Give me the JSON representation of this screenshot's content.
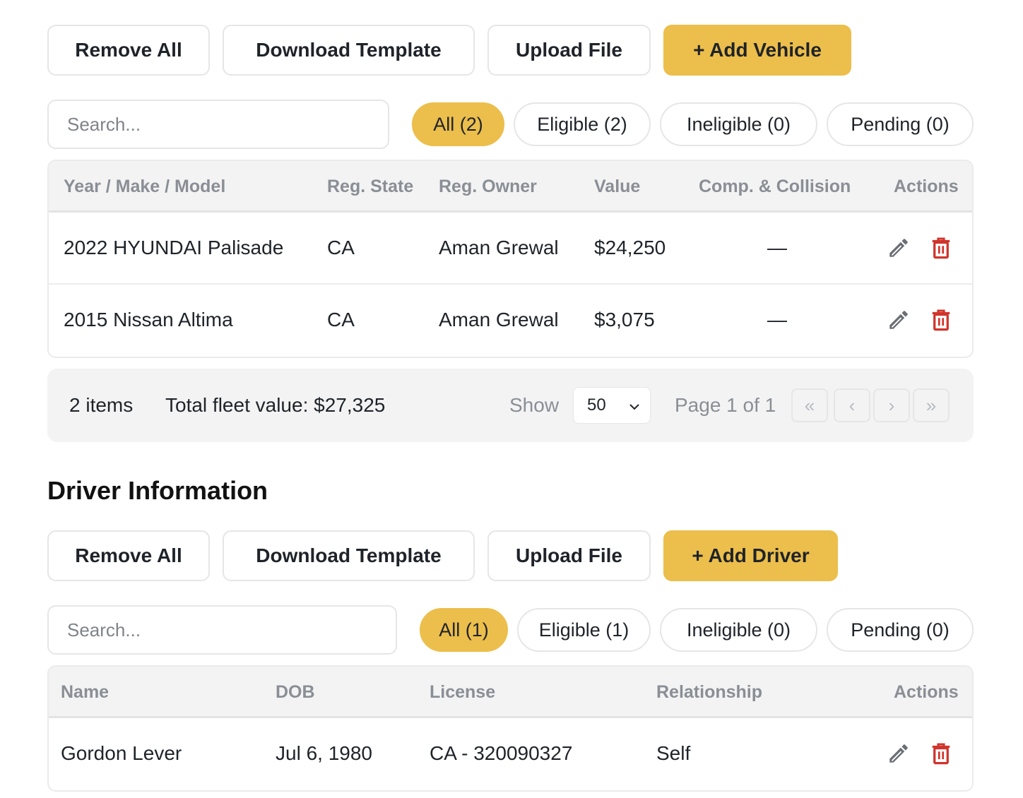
{
  "vehicles": {
    "toolbar": {
      "remove_all": "Remove All",
      "download_template": "Download Template",
      "upload_file": "Upload File",
      "add": "+ Add Vehicle"
    },
    "search": {
      "placeholder": "Search...",
      "value": ""
    },
    "filters": {
      "all": "All (2)",
      "eligible": "Eligible (2)",
      "ineligible": "Ineligible (0)",
      "pending": "Pending (0)"
    },
    "table": {
      "headers": {
        "ymm": "Year / Make / Model",
        "state": "Reg. State",
        "owner": "Reg. Owner",
        "value": "Value",
        "comp": "Comp. & Collision",
        "actions": "Actions"
      },
      "rows": [
        {
          "ymm": "2022 HYUNDAI Palisade",
          "state": "CA",
          "owner": "Aman Grewal",
          "value": "$24,250",
          "comp": "—"
        },
        {
          "ymm": "2015 Nissan Altima",
          "state": "CA",
          "owner": "Aman Grewal",
          "value": "$3,075",
          "comp": "—"
        }
      ]
    },
    "footer": {
      "items": "2 items",
      "total": "Total fleet value: $27,325",
      "show_label": "Show",
      "page_size": "50",
      "page_info": "Page 1 of 1",
      "first": "«",
      "prev": "‹",
      "next": "›",
      "last": "»"
    }
  },
  "drivers": {
    "heading": "Driver Information",
    "toolbar": {
      "remove_all": "Remove All",
      "download_template": "Download Template",
      "upload_file": "Upload File",
      "add": "+ Add Driver"
    },
    "search": {
      "placeholder": "Search...",
      "value": ""
    },
    "filters": {
      "all": "All (1)",
      "eligible": "Eligible (1)",
      "ineligible": "Ineligible (0)",
      "pending": "Pending (0)"
    },
    "table": {
      "headers": {
        "name": "Name",
        "dob": "DOB",
        "license": "License",
        "relationship": "Relationship",
        "actions": "Actions"
      },
      "rows": [
        {
          "name": "Gordon Lever",
          "dob": "Jul 6, 1980",
          "license": "CA - 320090327",
          "relationship": "Self"
        }
      ]
    }
  },
  "colors": {
    "accent": "#ecbe4b",
    "delete": "#d0342c",
    "edit": "#6b6e74",
    "header_text": "#8a8e95"
  },
  "icons": {
    "edit": "pencil-icon",
    "delete": "trash-icon",
    "dropdown": "chevron-down-icon"
  }
}
